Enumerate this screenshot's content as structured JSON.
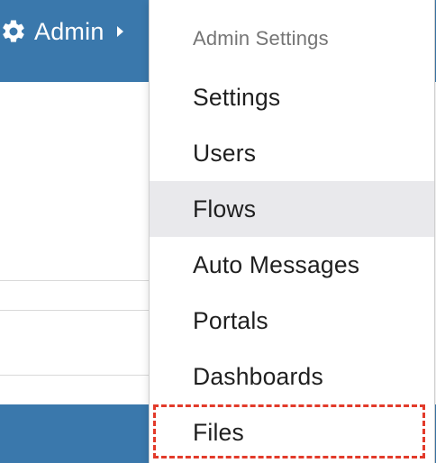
{
  "navbar": {
    "admin_label": "Admin",
    "icon": "gear-icon",
    "caret_icon": "caret-right-icon",
    "color": "#3a78ac"
  },
  "dropdown": {
    "header": "Admin Settings",
    "items": [
      {
        "label": "Settings",
        "active": false
      },
      {
        "label": "Users",
        "active": false
      },
      {
        "label": "Flows",
        "active": true
      },
      {
        "label": "Auto Messages",
        "active": false
      },
      {
        "label": "Portals",
        "active": false
      },
      {
        "label": "Dashboards",
        "active": false
      },
      {
        "label": "Files",
        "active": false,
        "highlighted": true
      }
    ],
    "highlight_color": "#e23a2a",
    "hover_color": "#e9e9ec"
  }
}
